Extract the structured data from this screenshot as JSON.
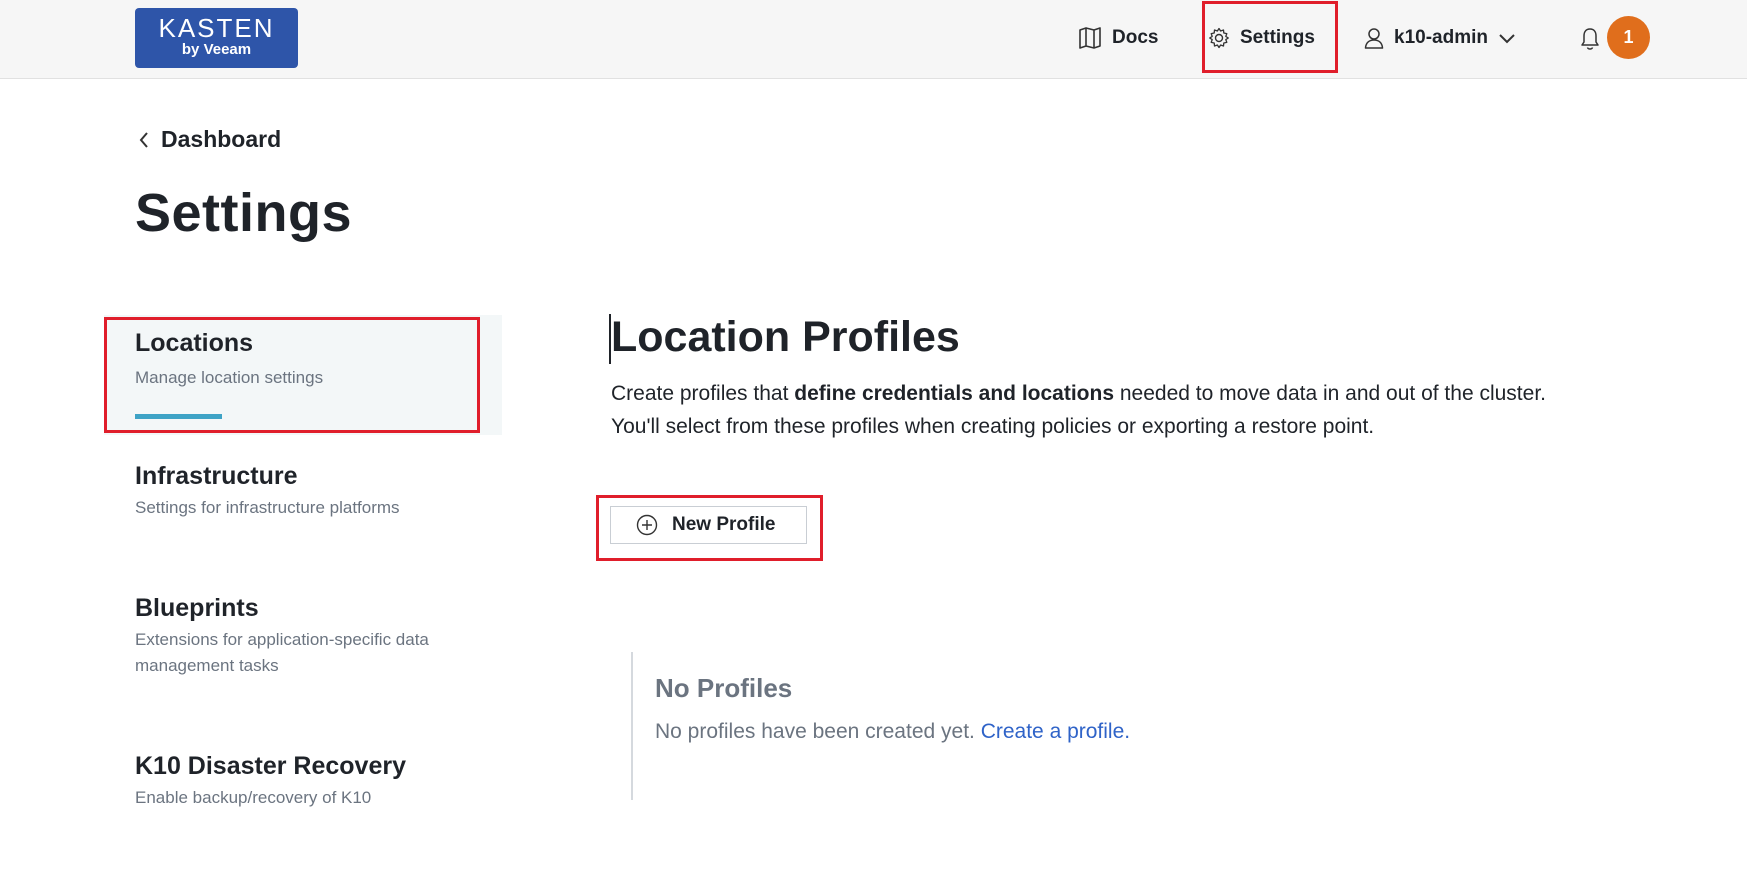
{
  "header": {
    "logo_line1": "KASTEN",
    "logo_line2": "by Veeam",
    "docs_label": "Docs",
    "settings_label": "Settings",
    "user_label": "k10-admin",
    "notification_count": "1",
    "badge_color": "#e06e1c",
    "brand_color": "#2e55a9"
  },
  "breadcrumb": {
    "label": "Dashboard"
  },
  "page": {
    "title": "Settings"
  },
  "sidebar": {
    "items": [
      {
        "title": "Locations",
        "desc": "Manage location settings",
        "active": true
      },
      {
        "title": "Infrastructure",
        "desc": "Settings for infrastructure platforms"
      },
      {
        "title": "Blueprints",
        "desc": "Extensions for application-specific data management tasks"
      },
      {
        "title": "K10 Disaster Recovery",
        "desc": "Enable backup/recovery of K10"
      }
    ]
  },
  "main": {
    "title": "Location Profiles",
    "desc_part1": "Create profiles that ",
    "desc_bold": "define credentials and locations",
    "desc_part2": " needed to move data in and out of the cluster.",
    "desc_line2": "You'll select from these profiles when creating policies or exporting a restore point.",
    "new_button_label": "New Profile",
    "empty_title": "No Profiles",
    "empty_text": "No profiles have been created yet. ",
    "empty_link": "Create a profile."
  },
  "highlight_color": "#e01e2b"
}
